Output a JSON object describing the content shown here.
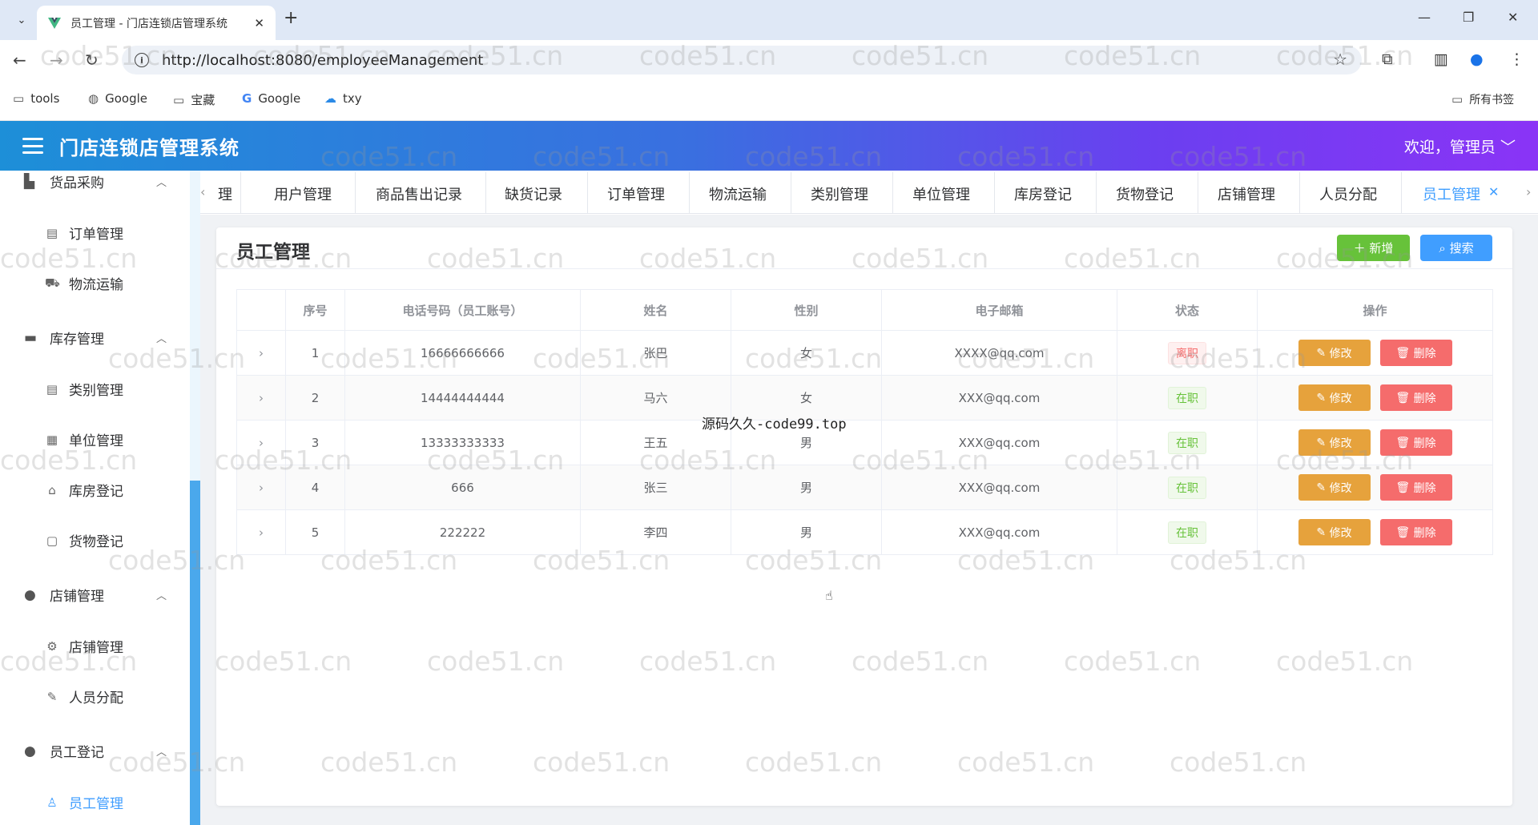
{
  "browser": {
    "tab_title": "员工管理 - 门店连锁店管理系统",
    "url": "http://localhost:8080/employeeManagement",
    "bookmarks": [
      "tools",
      "Google",
      "宝藏",
      "Google",
      "txy"
    ],
    "all_bookmarks": "所有书签"
  },
  "app": {
    "title": "门店连锁店管理系统",
    "welcome": "欢迎，管理员"
  },
  "sidebar": {
    "groups": [
      {
        "label": "货品采购",
        "icon": "cart-icon"
      },
      {
        "label": "库存管理",
        "icon": "briefcase-icon"
      },
      {
        "label": "店铺管理",
        "icon": "person-icon"
      },
      {
        "label": "员工登记",
        "icon": "person-icon"
      }
    ],
    "items": [
      {
        "label": "订单管理",
        "icon": "document-icon"
      },
      {
        "label": "物流运输",
        "icon": "truck-icon"
      },
      {
        "label": "类别管理",
        "icon": "document-icon"
      },
      {
        "label": "单位管理",
        "icon": "building-icon"
      },
      {
        "label": "库房登记",
        "icon": "house-icon"
      },
      {
        "label": "货物登记",
        "icon": "bag-icon"
      },
      {
        "label": "店铺管理",
        "icon": "gear-icon"
      },
      {
        "label": "人员分配",
        "icon": "edit-icon"
      },
      {
        "label": "员工管理",
        "icon": "user-icon"
      }
    ]
  },
  "tags": [
    "理",
    "用户管理",
    "商品售出记录",
    "缺货记录",
    "订单管理",
    "物流运输",
    "类别管理",
    "单位管理",
    "库房登记",
    "货物登记",
    "店铺管理",
    "人员分配",
    "员工管理"
  ],
  "page": {
    "title": "员工管理",
    "add_label": "新增",
    "search_label": "搜索"
  },
  "table": {
    "columns": [
      "序号",
      "电话号码（员工账号）",
      "姓名",
      "性别",
      "电子邮箱",
      "状态",
      "操作"
    ],
    "edit_label": "修改",
    "delete_label": "删除",
    "rows": [
      {
        "no": "1",
        "phone": "16666666666",
        "name": "张巴",
        "gender": "女",
        "email": "XXXX@qq.com",
        "status": "离职"
      },
      {
        "no": "2",
        "phone": "14444444444",
        "name": "马六",
        "gender": "女",
        "email": "XXX@qq.com",
        "status": "在职"
      },
      {
        "no": "3",
        "phone": "13333333333",
        "name": "王五",
        "gender": "男",
        "email": "XXX@qq.com",
        "status": "在职"
      },
      {
        "no": "4",
        "phone": "666",
        "name": "张三",
        "gender": "男",
        "email": "XXX@qq.com",
        "status": "在职"
      },
      {
        "no": "5",
        "phone": "222222",
        "name": "李四",
        "gender": "男",
        "email": "XXX@qq.com",
        "status": "在职"
      }
    ]
  },
  "overlay_text": "源码久久-code99.top",
  "watermark": "code51.cn",
  "colors": {
    "success": "#67c23a",
    "primary": "#409eff",
    "warning": "#e6a23c",
    "danger": "#f56c6c"
  }
}
